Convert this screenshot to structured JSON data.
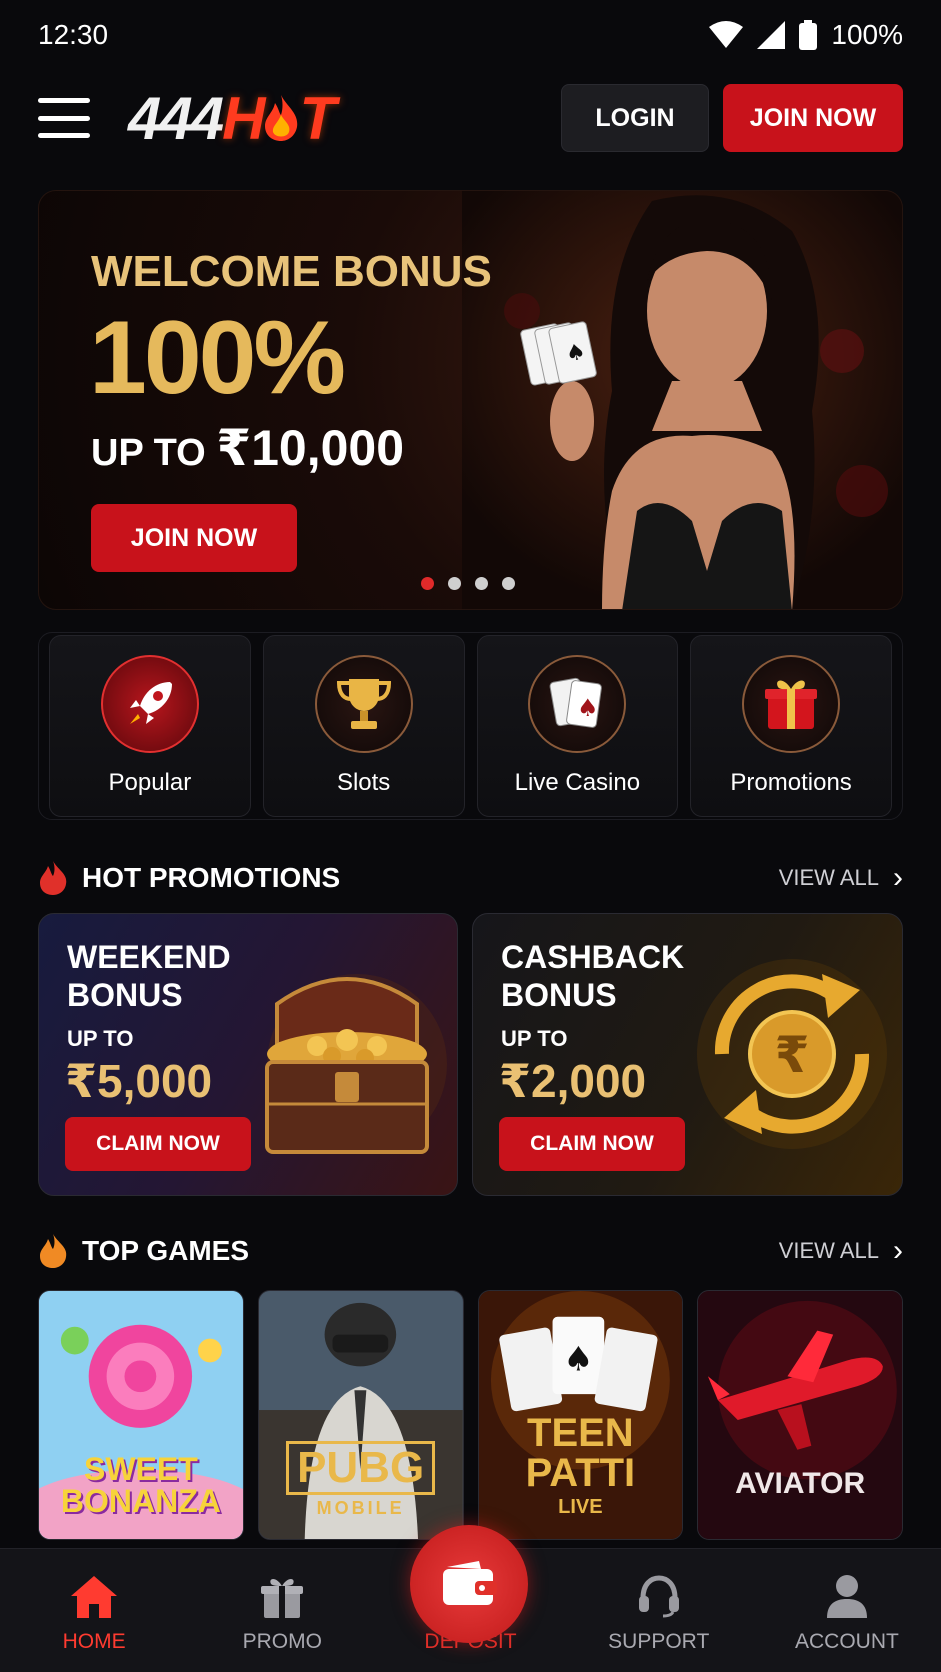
{
  "status_bar": {
    "time": "12:30",
    "battery": "100%"
  },
  "header": {
    "logo_prefix": "444",
    "logo_suffix_h": "H",
    "logo_suffix_t": "T",
    "login_label": "LOGIN",
    "join_label": "JOIN NOW"
  },
  "hero": {
    "title": "WELCOME BONUS",
    "percent": "100%",
    "upto_prefix": "UP TO ",
    "amount": "₹10,000",
    "button_label": "JOIN NOW",
    "slides": 4,
    "active_slide": 1
  },
  "categories": [
    {
      "label": "Popular",
      "icon": "rocket-icon"
    },
    {
      "label": "Slots",
      "icon": "trophy-icon"
    },
    {
      "label": "Live Casino",
      "icon": "playing-cards-icon"
    },
    {
      "label": "Promotions",
      "icon": "gift-icon"
    }
  ],
  "hot_promotions": {
    "title": "HOT PROMOTIONS",
    "view_all": "VIEW ALL",
    "items": [
      {
        "title": "WEEKEND BONUS",
        "upto": "UP TO",
        "amount": "₹5,000",
        "button": "CLAIM NOW",
        "art": "treasure-chest-icon"
      },
      {
        "title": "CASHBACK BONUS",
        "upto": "UP TO",
        "amount": "₹2,000",
        "button": "CLAIM NOW",
        "art": "rupee-cashback-icon"
      }
    ]
  },
  "top_games": {
    "title": "TOP GAMES",
    "view_all": "VIEW ALL",
    "items": [
      {
        "line1": "SWEET",
        "line2": "BONANZA",
        "line3": ""
      },
      {
        "line1": "PUBG",
        "line2": "MOBILE",
        "line3": ""
      },
      {
        "line1": "TEEN",
        "line2": "PATTI",
        "line3": "LIVE"
      },
      {
        "line1": "AVIATOR",
        "line2": "",
        "line3": ""
      }
    ]
  },
  "bottom_nav": {
    "items": [
      {
        "label": "HOME",
        "icon": "home-icon",
        "active": true
      },
      {
        "label": "PROMO",
        "icon": "gift-icon",
        "active": false
      },
      {
        "label": "DEPOSIT",
        "icon": "wallet-icon",
        "active": false
      },
      {
        "label": "SUPPORT",
        "icon": "headset-icon",
        "active": false
      },
      {
        "label": "ACCOUNT",
        "icon": "user-icon",
        "active": false
      }
    ]
  },
  "colors": {
    "accent_red": "#c8121b",
    "gold": "#e5b95c",
    "background": "#09090c"
  }
}
